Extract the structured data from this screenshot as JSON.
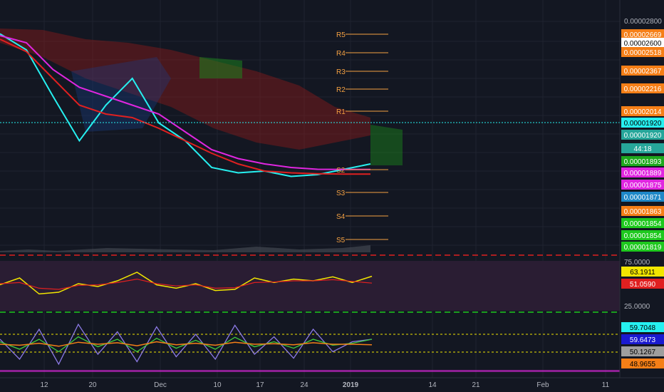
{
  "colors": {
    "background": "#131722",
    "grid": "#2a2e39",
    "axis_text": "#b2b5be",
    "pivot": "#f5a142",
    "cyan": "#26f0f0",
    "magenta": "#e026e0",
    "red": "#e02020",
    "green": "#3ecc3e",
    "yellow": "#f2e600",
    "rsi_bg": "#2a1d33"
  },
  "price_axis": {
    "tick": "0.00002800",
    "tags": [
      {
        "value": "0.00002669",
        "bg": "#f57f17",
        "fg": "#ffffff"
      },
      {
        "value": "0.00002600",
        "bg": "#ffffff",
        "fg": "#000000"
      },
      {
        "value": "0.00002518",
        "bg": "#f57f17",
        "fg": "#ffffff"
      },
      {
        "value": "0.00002367",
        "bg": "#f57f17",
        "fg": "#ffffff"
      },
      {
        "value": "0.00002216",
        "bg": "#f57f17",
        "fg": "#ffffff"
      },
      {
        "value": "0.00002014",
        "bg": "#f57f17",
        "fg": "#ffffff"
      },
      {
        "value": "0.00001920",
        "bg": "#26f0f0",
        "fg": "#000000"
      },
      {
        "value": "0.00001920",
        "bg": "#26a69a",
        "fg": "#ffffff"
      },
      {
        "value": "44:18",
        "bg": "#26a69a",
        "fg": "#ffffff"
      },
      {
        "value": "0.00001893",
        "bg": "#1ea81e",
        "fg": "#ffffff"
      },
      {
        "value": "0.00001889",
        "bg": "#e026e0",
        "fg": "#ffffff"
      },
      {
        "value": "0.00001875",
        "bg": "#e026e0",
        "fg": "#ffffff"
      },
      {
        "value": "0.00001871",
        "bg": "#1e88c8",
        "fg": "#ffffff"
      },
      {
        "value": "0.00001863",
        "bg": "#f57f17",
        "fg": "#ffffff"
      },
      {
        "value": "0.00001854",
        "bg": "#1ec81e",
        "fg": "#ffffff"
      },
      {
        "value": "0.00001854",
        "bg": "#1ec81e",
        "fg": "#ffffff"
      },
      {
        "value": "0.00001819",
        "bg": "#1ec81e",
        "fg": "#ffffff"
      }
    ]
  },
  "pivots": [
    "R5",
    "R4",
    "R3",
    "R2",
    "R1",
    "S2",
    "S3",
    "S4",
    "S5"
  ],
  "rsi": {
    "upper_label": "75.0000",
    "lower_label": "25.0000",
    "tags": [
      {
        "value": "63.1911",
        "bg": "#f2e600",
        "fg": "#000000"
      },
      {
        "value": "51.0590",
        "bg": "#e02020",
        "fg": "#ffffff"
      }
    ]
  },
  "stoch": {
    "tags": [
      {
        "value": "59.7048",
        "bg": "#26f0f0",
        "fg": "#000000"
      },
      {
        "value": "59.6473",
        "bg": "#1a1ad0",
        "fg": "#ffffff"
      },
      {
        "value": "50.1267",
        "bg": "#9e9e9e",
        "fg": "#000000"
      },
      {
        "value": "48.9655",
        "bg": "#f57f17",
        "fg": "#000000"
      }
    ]
  },
  "time_axis": [
    "12",
    "20",
    "Dec",
    "10",
    "17",
    "24",
    "2019",
    "14",
    "21",
    "Feb",
    "11"
  ],
  "chart_data": [
    {
      "type": "line",
      "pane": "price",
      "x_labels": [
        "12",
        "20",
        "Dec",
        "10",
        "17",
        "24",
        "2019",
        "14",
        "21",
        "Feb",
        "11"
      ],
      "series": [
        {
          "values": [
            2.65e-05,
            2.56e-05,
            2.3e-05,
            2.05e-05,
            2.25e-05,
            2.4e-05,
            2.15e-05,
            2.05e-05,
            1.9e-05,
            1.87e-05,
            1.88e-05,
            1.85e-05,
            1.86e-05,
            1.89e-05,
            1.92e-05
          ]
        },
        {
          "values": [
            2.64e-05,
            2.6e-05,
            2.45e-05,
            2.35e-05,
            2.3e-05,
            2.25e-05,
            2.2e-05,
            2.1e-05,
            2e-05,
            1.95e-05,
            1.92e-05,
            1.9e-05,
            1.89e-05,
            1.889e-05,
            1.889e-05
          ]
        },
        {
          "values": [
            2.62e-05,
            2.55e-05,
            2.4e-05,
            2.25e-05,
            2.2e-05,
            2.18e-05,
            2.12e-05,
            2.05e-05,
            1.98e-05,
            1.92e-05,
            1.88e-05,
            1.87e-05,
            1.865e-05,
            1.863e-05,
            1.863e-05
          ]
        }
      ]
    },
    {
      "type": "line",
      "pane": "rsi",
      "y_range": [
        0,
        100
      ],
      "series": [
        {
          "values": [
            48,
            60,
            32,
            35,
            50,
            45,
            55,
            70,
            48,
            42,
            50,
            38,
            40,
            60,
            52,
            58,
            55,
            62,
            52,
            63
          ]
        },
        {
          "values": [
            50,
            52,
            42,
            40,
            47,
            48,
            52,
            58,
            50,
            46,
            48,
            42,
            43,
            52,
            53,
            55,
            55,
            57,
            54,
            51
          ]
        }
      ]
    },
    {
      "type": "line",
      "pane": "stoch",
      "y_range": [
        0,
        100
      ],
      "series": [
        {
          "values": [
            60,
            20,
            80,
            10,
            90,
            30,
            75,
            15,
            85,
            25,
            70,
            20,
            88,
            30,
            65,
            22,
            80,
            35,
            55,
            60
          ]
        },
        {
          "values": [
            55,
            40,
            60,
            35,
            65,
            45,
            60,
            35,
            62,
            42,
            58,
            40,
            64,
            45,
            55,
            42,
            60,
            48,
            52,
            60
          ]
        },
        {
          "values": [
            50,
            48,
            52,
            46,
            54,
            50,
            53,
            47,
            55,
            49,
            52,
            48,
            54,
            50,
            51,
            49,
            53,
            50,
            50,
            49
          ]
        }
      ]
    }
  ]
}
